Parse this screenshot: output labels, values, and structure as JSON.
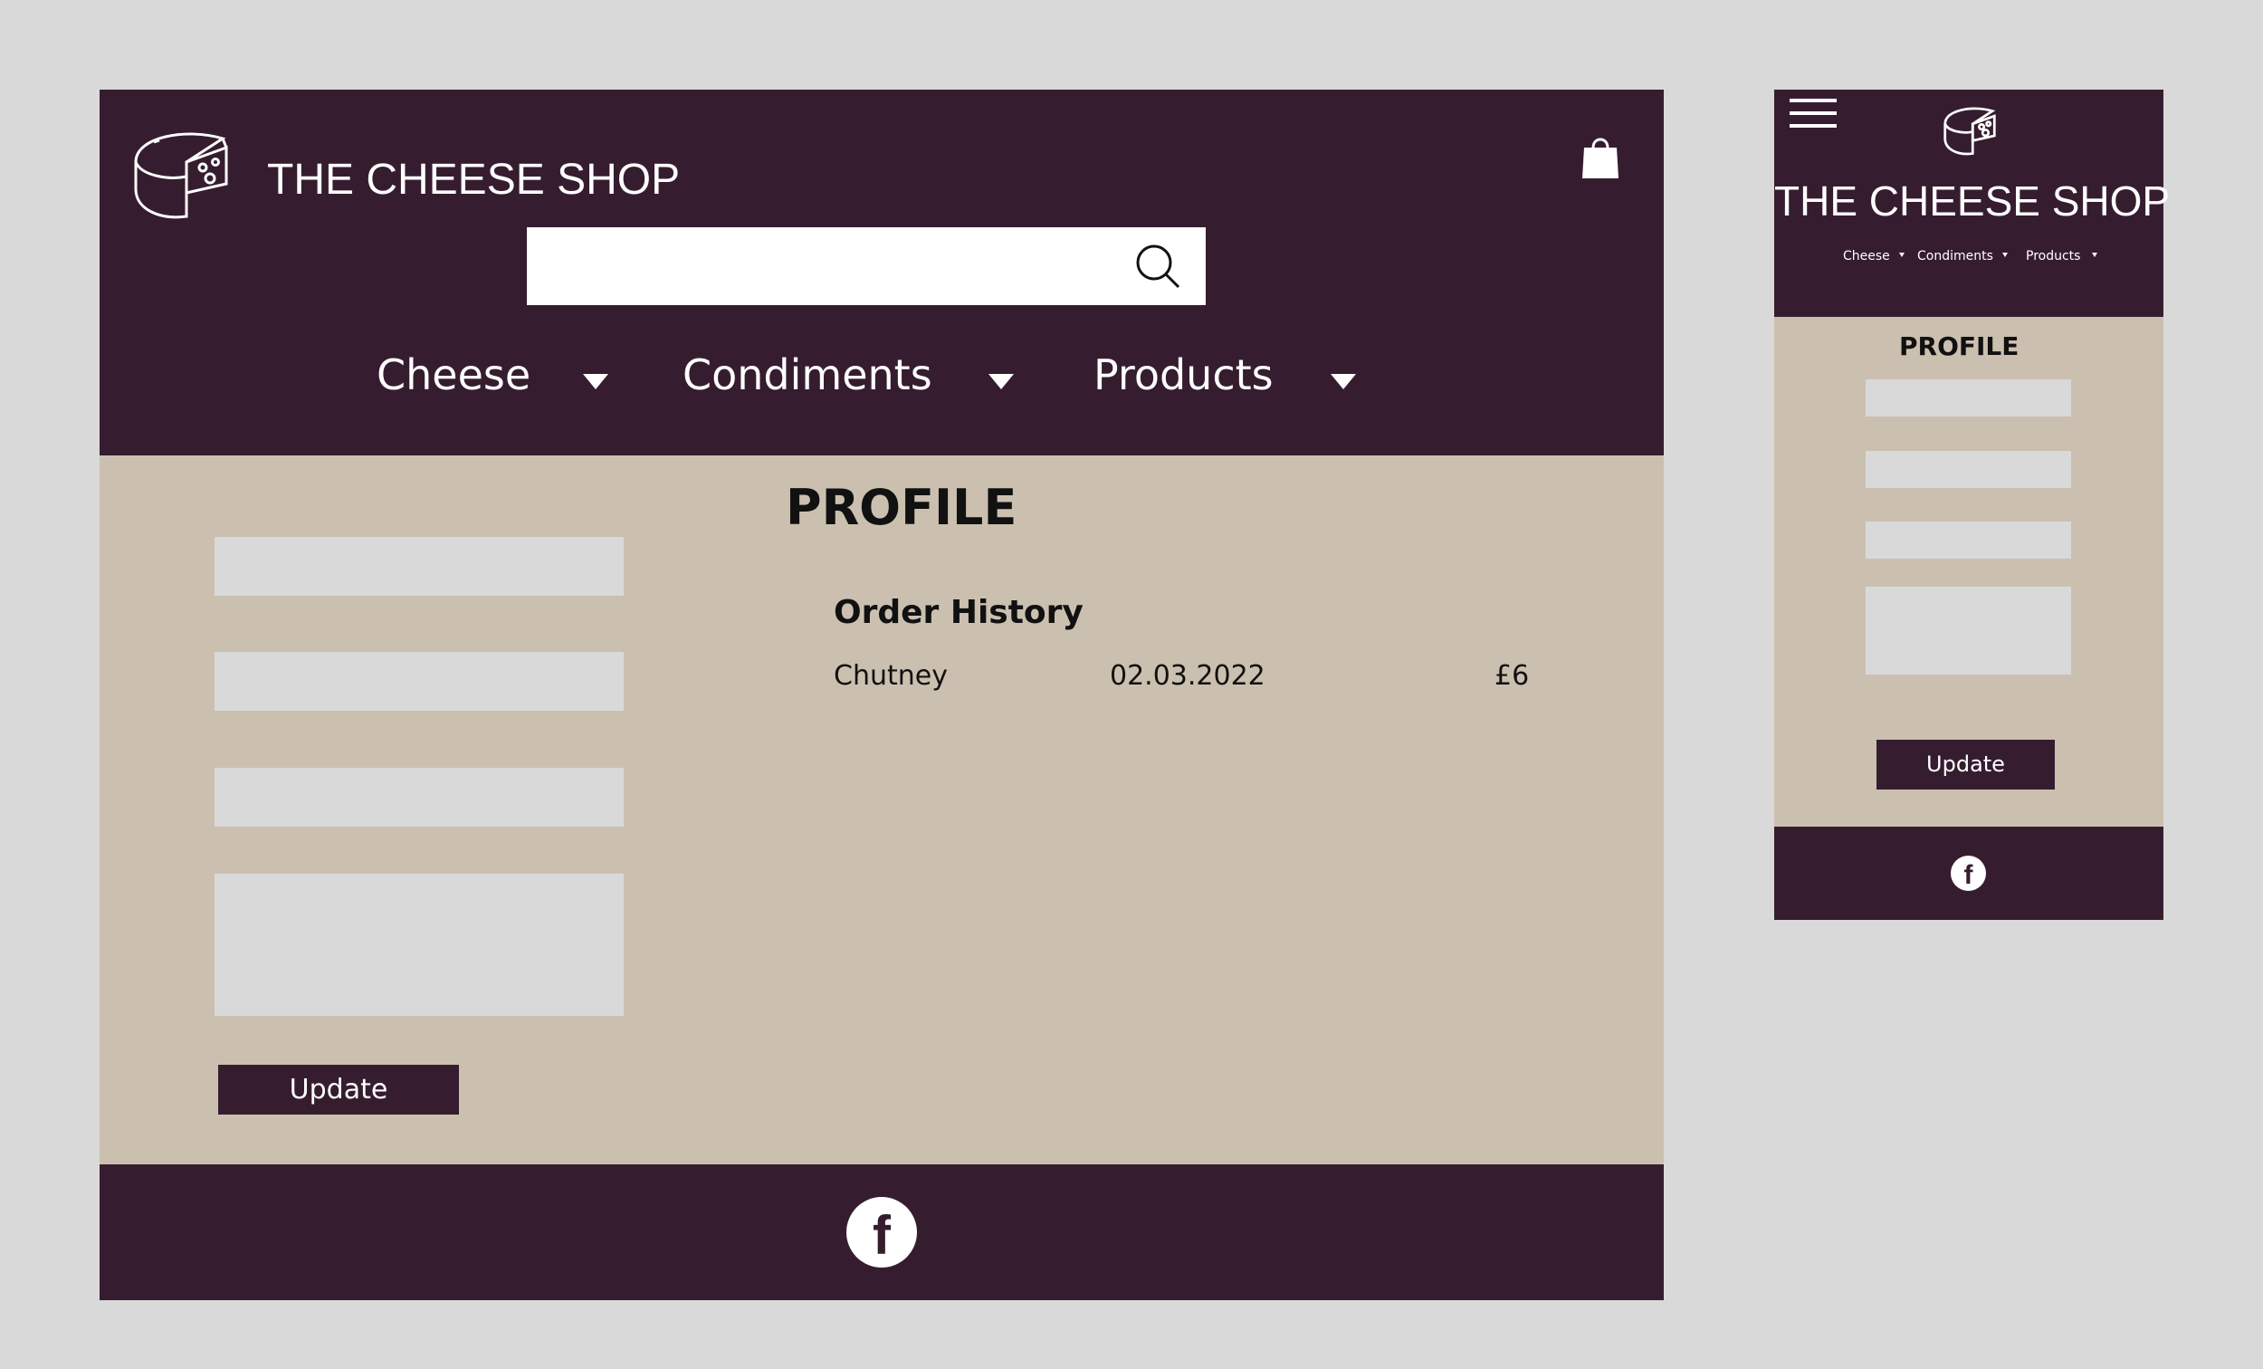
{
  "brand": {
    "title": "THE CHEESE SHOP"
  },
  "colors": {
    "header": "#351d2f",
    "content": "#cbc0af",
    "field": "#d9d9d9",
    "canvas": "#d9d9d9",
    "text_light": "#ffffff"
  },
  "icons": {
    "logo": "cheese-wheel-icon",
    "cart": "shopping-bag-icon",
    "search": "search-icon",
    "menu": "hamburger-menu-icon",
    "social": "facebook-icon",
    "dropdown": "caret-down-icon"
  },
  "nav": [
    {
      "label": "Cheese"
    },
    {
      "label": "Condiments"
    },
    {
      "label": "Products"
    }
  ],
  "search": {
    "value": "",
    "placeholder": ""
  },
  "profile": {
    "heading": "PROFILE",
    "fields": [
      {
        "value": ""
      },
      {
        "value": ""
      },
      {
        "value": ""
      },
      {
        "value": ""
      }
    ],
    "update_label": "Update"
  },
  "order_history": {
    "heading": "Order History",
    "orders": [
      {
        "item": "Chutney",
        "date": "02.03.2022",
        "price": "£6"
      }
    ]
  },
  "footer": {
    "social": "f"
  }
}
